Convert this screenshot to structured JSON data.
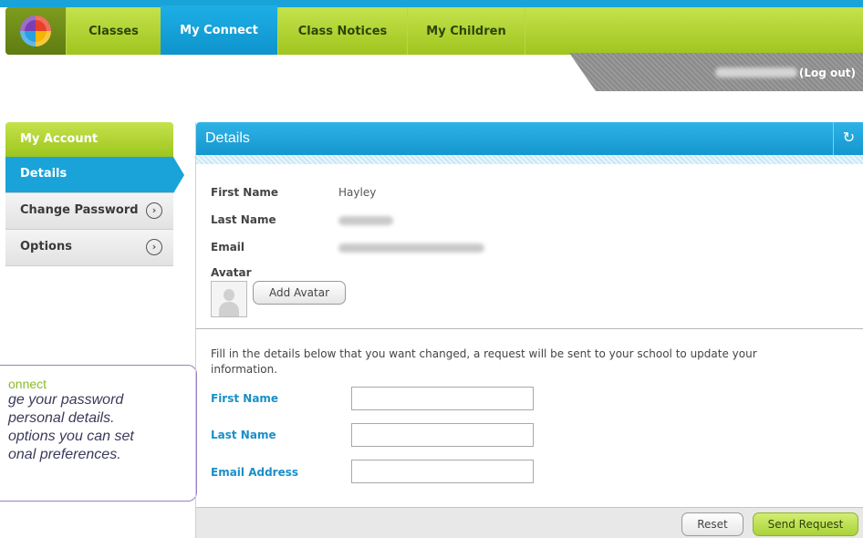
{
  "nav": {
    "tabs": [
      {
        "label": "Classes"
      },
      {
        "label": "My Connect"
      },
      {
        "label": "Class Notices"
      },
      {
        "label": "My Children"
      }
    ],
    "logout_label": "(Log out)"
  },
  "sidebar": {
    "header": "My Account",
    "items": [
      {
        "label": "Details"
      },
      {
        "label": "Change Password"
      },
      {
        "label": "Options"
      }
    ],
    "arrow_glyph": "›"
  },
  "tooltip": {
    "title": "onnect",
    "lines": [
      "ge your password",
      "personal details.",
      "options you can set",
      "onal preferences."
    ]
  },
  "panel": {
    "title": "Details",
    "refresh_glyph": "↻",
    "fields": [
      {
        "label": "First Name",
        "value": "Hayley"
      },
      {
        "label": "Last Name",
        "value": ""
      },
      {
        "label": "Email",
        "value": ""
      }
    ],
    "avatar_label": "Avatar",
    "add_avatar_label": "Add Avatar",
    "info_text": "Fill in the details below that you want changed, a request will be sent to your school to update your information.",
    "form": {
      "first_name_label": "First Name",
      "last_name_label": "Last Name",
      "email_label": "Email Address"
    },
    "reset_label": "Reset",
    "send_label": "Send Request"
  },
  "colors": {
    "accent_blue": "#1aa3d8",
    "accent_green": "#a9d23a",
    "tooltip_border": "#9b7fc4"
  }
}
